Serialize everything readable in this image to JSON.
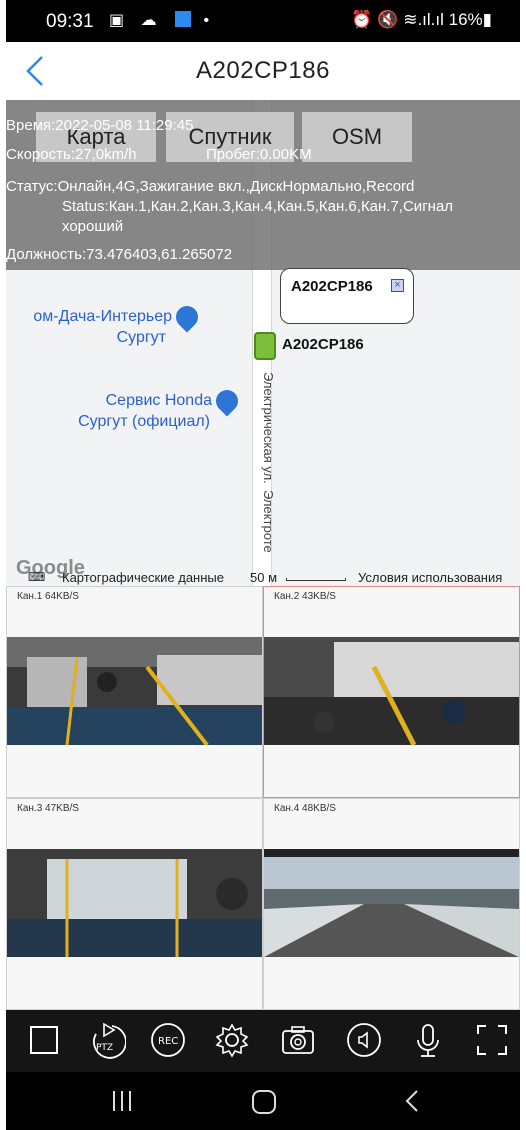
{
  "status_bar": {
    "time": "09:31",
    "left_icons": "▣ ☁",
    "dot": "•",
    "right_text": "⏰ 🔇 ≋.ıl.ıl 16%▮"
  },
  "header": {
    "title": "A202CP186"
  },
  "map": {
    "tabs": [
      "Карта",
      "Спутник",
      "OSM"
    ],
    "info": {
      "time": "Время:2022-05-08 11:29:45",
      "speed": "Скорость:27,0km/h",
      "mileage": "Пробег:0.00KM",
      "status_line1": "Статус:Онлайн,4G,Зажигание вкл.,ДискНормально,Record",
      "status_line2": "Status:Кан.1,Кан.2,Кан.3,Кан.4,Кан.5,Кан.6,Кан.7,Сигнал",
      "status_line3": "хороший",
      "position": "Должность:73.476403,61.265072"
    },
    "road_labels": [
      "Электрическая ул.",
      "Электроте"
    ],
    "pois": [
      {
        "line1": "ом-Дача-Интерьер",
        "line2": "Сургут"
      },
      {
        "line1": "Сервис Honda",
        "line2": "Сургут (официал)"
      }
    ],
    "callout_title": "A202CP186",
    "vehicle_label": "A202CP186",
    "attribution": {
      "logo": "Google",
      "data": "Картографические данные",
      "scale": "50 м",
      "terms": "Условия использования"
    }
  },
  "video": {
    "cells": [
      {
        "label": "Кан.1 64KB/S"
      },
      {
        "label": "Кан.2 43KB/S"
      },
      {
        "label": "Кан.3 47KB/S"
      },
      {
        "label": "Кан.4 48KB/S"
      }
    ]
  },
  "toolbar": {
    "ptz": "PTZ",
    "rec": "REC"
  },
  "colors": {
    "accent": "#2e8af0",
    "overlay": "#6e6e6e",
    "toolbar": "#151515",
    "bus": "#7bbf3a",
    "active_cell_border": "#e08a8a"
  }
}
